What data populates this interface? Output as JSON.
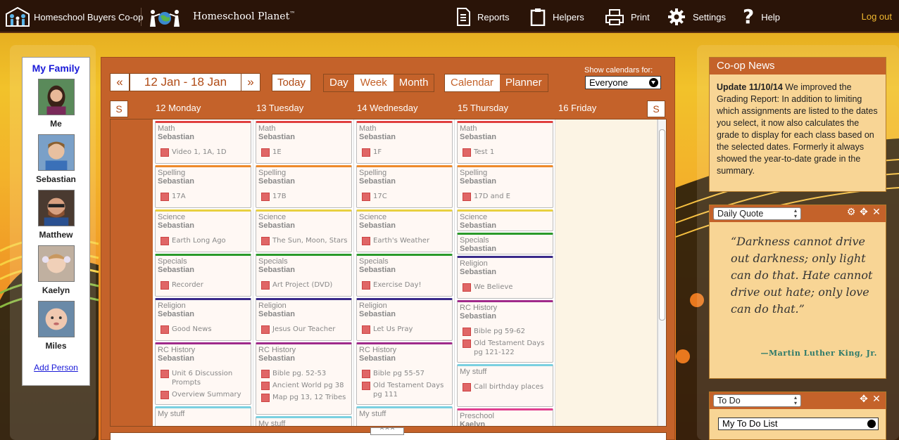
{
  "brand": {
    "coop": "Homeschool Buyers Co-op",
    "planet": "Homeschool Planet",
    "tm": "™"
  },
  "nav": {
    "reports": "Reports",
    "helpers": "Helpers",
    "print": "Print",
    "settings": "Settings",
    "help": "Help",
    "logout": "Log out"
  },
  "family": {
    "title": "My Family",
    "members": [
      "Me",
      "Sebastian",
      "Matthew",
      "Kaelyn",
      "Miles"
    ],
    "add": "Add Person"
  },
  "toolbar": {
    "prev": "«",
    "range": "12 Jan - 18 Jan",
    "next": "»",
    "today": "Today",
    "day": "Day",
    "week": "Week",
    "month": "Month",
    "calendar": "Calendar",
    "planner": "Planner",
    "show_for": "Show calendars for:",
    "everyone": "Everyone",
    "s_left": "S",
    "s_right": "S"
  },
  "days": [
    "12 Monday",
    "13 Tuesday",
    "14 Wednesday",
    "15 Thursday",
    "16 Friday"
  ],
  "columns": [
    [
      {
        "subject": "Math",
        "student": "Sebastian",
        "items": [
          "Video 1, 1A, 1D"
        ],
        "color": "#e04040"
      },
      {
        "subject": "Spelling",
        "student": "Sebastian",
        "items": [
          "17A"
        ],
        "color": "#ee8a2a"
      },
      {
        "subject": "Science",
        "student": "Sebastian",
        "items": [
          "Earth Long Ago"
        ],
        "color": "#e8d040"
      },
      {
        "subject": "Specials",
        "student": "Sebastian",
        "items": [
          "Recorder"
        ],
        "color": "#2a9a2a"
      },
      {
        "subject": "Religion",
        "student": "Sebastian",
        "items": [
          "Good News"
        ],
        "color": "#3a2a8a"
      },
      {
        "subject": "RC History",
        "student": "Sebastian",
        "items": [
          "Unit 6 Discussion Prompts",
          "Overview Summary"
        ],
        "color": "#a02a8a"
      },
      {
        "subject": "My stuff",
        "student": "",
        "items": [],
        "color": "#7ad0e0"
      }
    ],
    [
      {
        "subject": "Math",
        "student": "Sebastian",
        "items": [
          "1E"
        ],
        "color": "#e04040"
      },
      {
        "subject": "Spelling",
        "student": "Sebastian",
        "items": [
          "17B"
        ],
        "color": "#ee8a2a"
      },
      {
        "subject": "Science",
        "student": "Sebastian",
        "items": [
          "The Sun, Moon, Stars"
        ],
        "color": "#e8d040"
      },
      {
        "subject": "Specials",
        "student": "Sebastian",
        "items": [
          "Art Project (DVD)"
        ],
        "color": "#2a9a2a"
      },
      {
        "subject": "Religion",
        "student": "Sebastian",
        "items": [
          "Jesus Our Teacher"
        ],
        "color": "#3a2a8a"
      },
      {
        "subject": "RC History",
        "student": "Sebastian",
        "items": [
          "Bible pg. 52-53",
          "Ancient World pg 38",
          "Map pg 13, 12 Tribes"
        ],
        "color": "#a02a8a"
      },
      {
        "subject": "My stuff",
        "student": "",
        "items": [],
        "color": "#7ad0e0"
      }
    ],
    [
      {
        "subject": "Math",
        "student": "Sebastian",
        "items": [
          "1F"
        ],
        "color": "#e04040"
      },
      {
        "subject": "Spelling",
        "student": "Sebastian",
        "items": [
          "17C"
        ],
        "color": "#ee8a2a"
      },
      {
        "subject": "Science",
        "student": "Sebastian",
        "items": [
          "Earth's Weather"
        ],
        "color": "#e8d040"
      },
      {
        "subject": "Specials",
        "student": "Sebastian",
        "items": [
          "Exercise Day!"
        ],
        "color": "#2a9a2a"
      },
      {
        "subject": "Religion",
        "student": "Sebastian",
        "items": [
          "Let Us Pray"
        ],
        "color": "#3a2a8a"
      },
      {
        "subject": "RC History",
        "student": "Sebastian",
        "items": [
          "Bible pg 55-57",
          "Old Testament Days pg 111"
        ],
        "color": "#a02a8a"
      },
      {
        "subject": "My stuff",
        "student": "",
        "items": [],
        "color": "#7ad0e0"
      }
    ],
    [
      {
        "subject": "Math",
        "student": "Sebastian",
        "items": [
          "Test 1"
        ],
        "color": "#e04040"
      },
      {
        "subject": "Spelling",
        "student": "Sebastian",
        "items": [
          "17D and E"
        ],
        "color": "#ee8a2a"
      },
      {
        "subject": "Science",
        "student": "Sebastian",
        "items": [],
        "color": "#e8d040"
      },
      {
        "subject": "Specials",
        "student": "Sebastian",
        "items": [],
        "color": "#2a9a2a"
      },
      {
        "subject": "Religion",
        "student": "Sebastian",
        "items": [
          "We Believe"
        ],
        "color": "#3a2a8a"
      },
      {
        "subject": "RC History",
        "student": "Sebastian",
        "items": [
          "Bible pg 59-62",
          "Old Testament Days pg 121-122"
        ],
        "color": "#a02a8a"
      },
      {
        "subject": "My stuff",
        "student": "",
        "items": [
          "Call birthday places"
        ],
        "color": "#7ad0e0"
      },
      {
        "subject": "Preschool",
        "student": "Kaelyn",
        "items": [],
        "color": "#e04090"
      }
    ]
  ],
  "expand": "^^^",
  "news": {
    "title": "Co-op News",
    "lead": "Update 11/10/14",
    "body": " We improved the Grading Report: In addition to limiting which assignments are listed to the dates you select, it now also calculates the grade to display for each class based on the selected dates. Formerly it always showed the year-to-date grade in the summary."
  },
  "quote": {
    "widget": "Daily Quote",
    "text": "“Darkness cannot drive out darkness; only light can do that. Hate cannot drive out hate; only love can do that.”",
    "author": "—Martin Luther King, Jr."
  },
  "todo": {
    "widget": "To Do",
    "list": "My To Do List"
  }
}
